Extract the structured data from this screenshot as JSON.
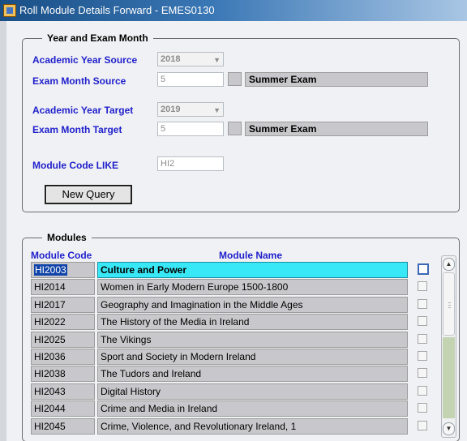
{
  "window": {
    "title": "Roll Module Details Forward - EMES0130"
  },
  "year_exam": {
    "legend": "Year and Exam Month",
    "academic_year_source_label": "Academic Year Source",
    "academic_year_source_value": "2018",
    "exam_month_source_label": "Exam Month Source",
    "exam_month_source_value": "5",
    "exam_month_source_desc": "Summer Exam",
    "academic_year_target_label": "Academic Year Target",
    "academic_year_target_value": "2019",
    "exam_month_target_label": "Exam Month Target",
    "exam_month_target_value": "5",
    "exam_month_target_desc": "Summer Exam",
    "module_code_like_label": "Module Code LIKE",
    "module_code_like_value": "HI2",
    "new_query_label": "New Query"
  },
  "modules": {
    "legend": "Modules",
    "col_code": "Module Code",
    "col_name": "Module Name",
    "rows": [
      {
        "code": "HI2003",
        "name": "Culture and Power",
        "selected": true
      },
      {
        "code": "HI2014",
        "name": "Women in Early Modern Europe 1500-1800"
      },
      {
        "code": "HI2017",
        "name": "Geography  and Imagination in the Middle Ages"
      },
      {
        "code": "HI2022",
        "name": "The History of the Media in Ireland"
      },
      {
        "code": "HI2025",
        "name": "The Vikings"
      },
      {
        "code": "HI2036",
        "name": "Sport and Society in Modern Ireland"
      },
      {
        "code": "HI2038",
        "name": "The Tudors and Ireland"
      },
      {
        "code": "HI2043",
        "name": "Digital History"
      },
      {
        "code": "HI2044",
        "name": "Crime and Media in Ireland"
      },
      {
        "code": "HI2045",
        "name": "Crime, Violence, and Revolutionary Ireland, 1"
      }
    ]
  }
}
